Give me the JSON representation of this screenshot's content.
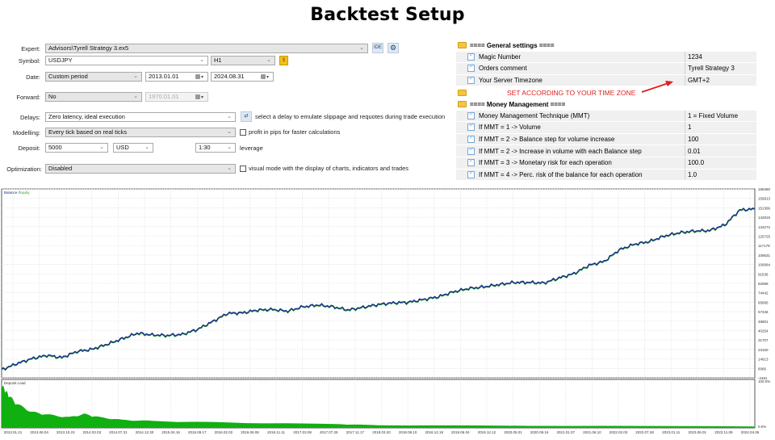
{
  "title": "Backtest Setup",
  "settings": {
    "expert": {
      "label": "Expert:",
      "value": "Advisors\\Tyrell Strategy 3.ex5"
    },
    "ide_label": "IDE",
    "symbol": {
      "label": "Symbol:",
      "value": "USDJPY",
      "timeframe": "H1"
    },
    "date": {
      "label": "Date:",
      "value": "Custom period",
      "from": "2013.01.01",
      "to": "2024.08.31"
    },
    "forward": {
      "label": "Forward:",
      "value": "No",
      "date": "1970.01.01"
    },
    "delays": {
      "label": "Delays:",
      "value": "Zero latency, ideal execution",
      "hint": "select a delay to emulate slippage and requotes during trade execution"
    },
    "modelling": {
      "label": "Modelling:",
      "value": "Every tick based on real ticks",
      "checkbox_label": "profit in pips for faster calculations"
    },
    "deposit": {
      "label": "Deposit:",
      "value": "5000",
      "currency": "USD",
      "leverage": "1:30",
      "leverage_label": "leverage"
    },
    "optimization": {
      "label": "Optimization:",
      "value": "Disabled",
      "checkbox_label": "visual mode with the display of charts, indicators and trades"
    }
  },
  "parameters": {
    "general_group": "====   General settings   ====",
    "general": [
      {
        "name": "Magic Number",
        "value": "1234"
      },
      {
        "name": "Orders comment",
        "value": "Tyrell Strategy 3"
      },
      {
        "name": "Your Server Timezone",
        "value": "GMT+2"
      }
    ],
    "money_group": "====   Money Management   ====",
    "money": [
      {
        "name": "Money Management Technique (MMT)",
        "value": "1 = Fixed Volume"
      },
      {
        "name": "If MMT = 1 -> Volume",
        "value": "1"
      },
      {
        "name": "If MMT = 2 -> Balance step for volume increase",
        "value": "100"
      },
      {
        "name": "If MMT = 2 -> Increase in volume with each Balance step",
        "value": "0.01"
      },
      {
        "name": "If MMT = 3 -> Monetary risk for each operation",
        "value": "100.0"
      },
      {
        "name": "If MMT = 4 -> Perc. risk of the balance for each operation",
        "value": "1.0"
      }
    ],
    "annotation": "SET ACCORDING TO YOUR TIME ZONE"
  },
  "colors": {
    "balance": "#1a2f8a",
    "equity": "#2aa52a",
    "deposit_load": "#10b010",
    "annotation": "#e02020"
  },
  "chart_data": [
    {
      "type": "line",
      "title": "Balance / Equity",
      "legend": [
        "Balance",
        "Equity"
      ],
      "ylim": [
        -2481,
        168460
      ],
      "yticks": [
        168460,
        159913,
        151366,
        142819,
        134272,
        125725,
        117178,
        108631,
        100084,
        91536,
        82989,
        74442,
        65895,
        57348,
        48801,
        40254,
        31707,
        23160,
        14613,
        6066,
        -2481
      ],
      "grid": true,
      "series": [
        {
          "name": "Balance",
          "x": [
            0,
            0.02,
            0.04,
            0.06,
            0.08,
            0.1,
            0.12,
            0.14,
            0.16,
            0.18,
            0.2,
            0.22,
            0.24,
            0.26,
            0.28,
            0.3,
            0.32,
            0.34,
            0.36,
            0.38,
            0.4,
            0.42,
            0.44,
            0.46,
            0.48,
            0.5,
            0.52,
            0.54,
            0.56,
            0.58,
            0.6,
            0.62,
            0.64,
            0.66,
            0.68,
            0.7,
            0.72,
            0.74,
            0.76,
            0.78,
            0.8,
            0.82,
            0.84,
            0.86,
            0.88,
            0.9,
            0.92,
            0.94,
            0.96,
            0.98,
            1.0
          ],
          "values": [
            5000,
            10500,
            15000,
            18000,
            16000,
            21500,
            23500,
            28000,
            33000,
            38000,
            36500,
            36000,
            37000,
            41500,
            48500,
            56000,
            56500,
            59000,
            59500,
            58000,
            62000,
            63500,
            62000,
            59000,
            61500,
            64000,
            65500,
            66000,
            68500,
            71000,
            75500,
            78500,
            80000,
            82000,
            84000,
            84000,
            83500,
            88000,
            92000,
            99500,
            103000,
            113500,
            118500,
            121000,
            126000,
            129000,
            130500,
            131000,
            136000,
            149500,
            150500
          ]
        },
        {
          "name": "Equity",
          "x": [
            0,
            1.0
          ],
          "values": [
            5000,
            150500
          ]
        }
      ]
    },
    {
      "type": "area",
      "title": "Deposit Load",
      "ylim": [
        0,
        100
      ],
      "yticks": [
        "100.0%",
        "0.0%"
      ],
      "xticks": [
        "2013.01.21",
        "2013.06.04",
        "2013.10.23",
        "2014.03.03",
        "2014.07.31",
        "2014.12.30",
        "2015.04.16",
        "2015.09.17",
        "2016.02.02",
        "2016.06.08",
        "2016.11.11",
        "2017.03.08",
        "2017.07.25",
        "2017.11.17",
        "2018.03.20",
        "2018.08.10",
        "2018.12.19",
        "2019.06.04",
        "2019.12.12",
        "2020.05.01",
        "2020.09.16",
        "2021.01.07",
        "2021.06.10",
        "2022.02.03",
        "2022.07.28",
        "2023.01.11",
        "2023.06.01",
        "2023.11.09",
        "2024.04.05"
      ],
      "x": [
        0,
        0.005,
        0.01,
        0.02,
        0.04,
        0.06,
        0.09,
        0.11,
        0.13,
        0.16,
        0.2,
        0.3,
        0.45,
        0.5,
        0.7,
        1.0
      ],
      "values": [
        80,
        70,
        60,
        45,
        30,
        25,
        20,
        26,
        20,
        15,
        13,
        10,
        7,
        5,
        4,
        3
      ]
    }
  ]
}
